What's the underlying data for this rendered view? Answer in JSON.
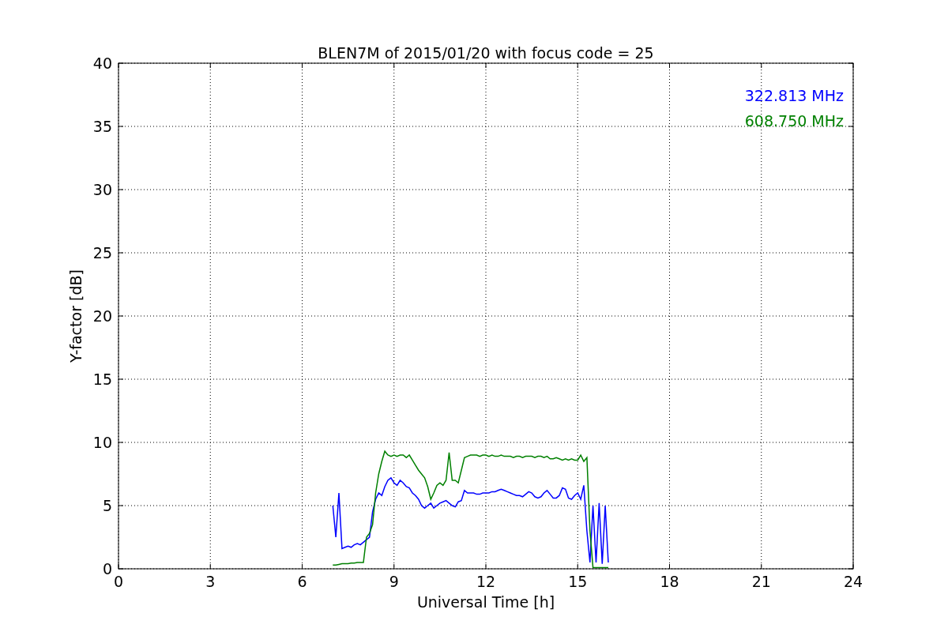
{
  "figure": {
    "chart_data": {
      "type": "line",
      "grid": true,
      "title": "BLEN7M of 2015/01/20 with focus code = 25",
      "xlabel": "Universal Time [h]",
      "ylabel": "Y-factor [dB]",
      "xlim": [
        0,
        24
      ],
      "ylim": [
        0,
        40
      ],
      "xticks": [
        0,
        3,
        6,
        9,
        12,
        15,
        18,
        21,
        24
      ],
      "yticks": [
        0,
        5,
        10,
        15,
        20,
        25,
        30,
        35,
        40
      ],
      "x": [
        7.0,
        7.1,
        7.2,
        7.3,
        7.4,
        7.5,
        7.6,
        7.7,
        7.8,
        7.9,
        8.0,
        8.1,
        8.2,
        8.3,
        8.4,
        8.5,
        8.6,
        8.7,
        8.8,
        8.9,
        9.0,
        9.1,
        9.2,
        9.3,
        9.4,
        9.5,
        9.6,
        9.7,
        9.8,
        9.9,
        10.0,
        10.1,
        10.2,
        10.3,
        10.4,
        10.5,
        10.6,
        10.7,
        10.8,
        10.9,
        11.0,
        11.1,
        11.2,
        11.3,
        11.4,
        11.5,
        11.6,
        11.7,
        11.8,
        11.9,
        12.0,
        12.1,
        12.2,
        12.3,
        12.4,
        12.5,
        12.6,
        12.7,
        12.8,
        12.9,
        13.0,
        13.1,
        13.2,
        13.3,
        13.4,
        13.5,
        13.6,
        13.7,
        13.8,
        13.9,
        14.0,
        14.1,
        14.2,
        14.3,
        14.4,
        14.5,
        14.6,
        14.7,
        14.8,
        14.9,
        15.0,
        15.1,
        15.2,
        15.3,
        15.4,
        15.5,
        15.6,
        15.7,
        15.8,
        15.9,
        16.0
      ],
      "series": [
        {
          "name": "322.813 MHz",
          "color": "#0000ff",
          "values": [
            5.0,
            2.5,
            6.0,
            1.6,
            1.7,
            1.8,
            1.7,
            1.9,
            2.0,
            1.9,
            2.1,
            2.3,
            2.5,
            4.5,
            5.5,
            6.0,
            5.8,
            6.5,
            7.0,
            7.2,
            6.8,
            6.6,
            7.0,
            6.8,
            6.5,
            6.4,
            6.0,
            5.8,
            5.5,
            5.0,
            4.8,
            5.0,
            5.2,
            4.8,
            5.0,
            5.2,
            5.3,
            5.4,
            5.2,
            5.0,
            4.9,
            5.3,
            5.4,
            6.2,
            6.0,
            6.0,
            6.0,
            5.9,
            5.9,
            6.0,
            6.0,
            6.0,
            6.1,
            6.1,
            6.2,
            6.3,
            6.2,
            6.1,
            6.0,
            5.9,
            5.8,
            5.8,
            5.7,
            5.9,
            6.1,
            6.0,
            5.7,
            5.6,
            5.7,
            6.0,
            6.2,
            5.9,
            5.6,
            5.6,
            5.8,
            6.4,
            6.3,
            5.6,
            5.5,
            5.8,
            6.0,
            5.5,
            6.6,
            3.0,
            0.5,
            5.0,
            0.5,
            5.2,
            0.4,
            5.0,
            0.5
          ]
        },
        {
          "name": "608.750 MHz",
          "color": "#008000",
          "values": [
            0.3,
            0.3,
            0.35,
            0.4,
            0.4,
            0.4,
            0.45,
            0.45,
            0.5,
            0.5,
            0.5,
            2.5,
            2.8,
            3.5,
            6.0,
            7.5,
            8.5,
            9.3,
            9.0,
            8.9,
            9.0,
            8.9,
            9.0,
            9.0,
            8.8,
            9.0,
            8.6,
            8.2,
            7.8,
            7.5,
            7.2,
            6.5,
            5.5,
            6.0,
            6.6,
            6.8,
            6.6,
            7.0,
            9.2,
            7.0,
            7.0,
            6.8,
            7.8,
            8.8,
            8.9,
            9.0,
            9.0,
            9.0,
            8.9,
            9.0,
            9.0,
            8.9,
            9.0,
            8.9,
            8.9,
            9.0,
            8.9,
            8.9,
            8.9,
            8.8,
            8.9,
            8.9,
            8.8,
            8.9,
            8.9,
            8.9,
            8.8,
            8.9,
            8.9,
            8.8,
            8.9,
            8.7,
            8.7,
            8.8,
            8.7,
            8.6,
            8.7,
            8.6,
            8.7,
            8.6,
            8.6,
            9.0,
            8.5,
            8.8,
            3.0,
            0.1,
            0.1,
            0.1,
            0.1,
            0.1,
            0.1
          ]
        }
      ]
    }
  }
}
